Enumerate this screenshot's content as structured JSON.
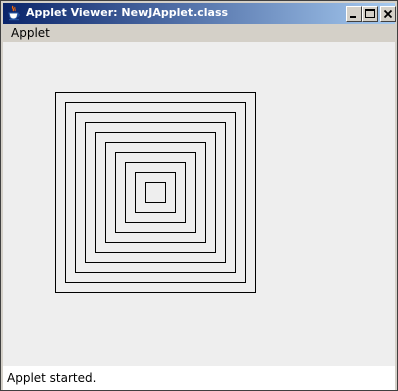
{
  "window": {
    "title": "Applet Viewer: NewJApplet.class",
    "icon": "java-cup-icon",
    "controls": [
      "minimize-icon",
      "maximize-icon",
      "close-icon"
    ]
  },
  "menubar": {
    "items": [
      {
        "label": "Applet"
      }
    ]
  },
  "applet": {
    "drawing": "concentric-squares",
    "square_count": 10,
    "stroke_color": "#000000",
    "background": "#eeeeee"
  },
  "statusbar": {
    "text": "Applet started."
  },
  "colors": {
    "title_gradient_start": "#0a246a",
    "title_gradient_end": "#a6caf0",
    "chrome": "#d4d0c8"
  }
}
